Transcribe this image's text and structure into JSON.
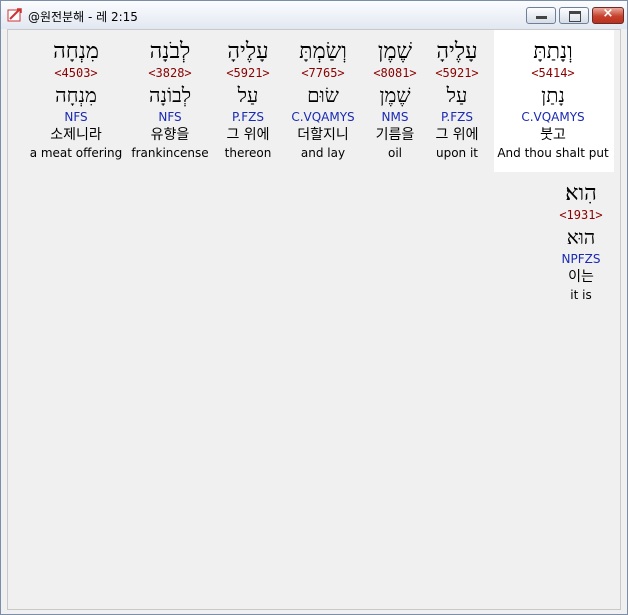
{
  "window": {
    "title": "@원전분해 - 레 2:15"
  },
  "titlebar": {
    "minimize": "minimize",
    "maximize": "maximize",
    "close": "×"
  },
  "verse": {
    "words": [
      {
        "hebrew": "וְנָתַתָּ",
        "strong": "<5414>",
        "lemma": "נָתַן",
        "parse": "C.VQAMYS",
        "korean": "붓고",
        "english": "And thou shalt put"
      },
      {
        "hebrew": "עָלֶיהָ",
        "strong": "<5921>",
        "lemma": "עַל",
        "parse": "P.FZS",
        "korean": "그 위에",
        "english": "upon it"
      },
      {
        "hebrew": "שֶׁמֶן",
        "strong": "<8081>",
        "lemma": "שֶׁמֶן",
        "parse": "NMS",
        "korean": "기름을",
        "english": "oil"
      },
      {
        "hebrew": "וְשַׂמְתָּ",
        "strong": "<7765>",
        "lemma": "שׂוּם",
        "parse": "C.VQAMYS",
        "korean": "더할지니",
        "english": "and lay"
      },
      {
        "hebrew": "עָלֶיהָ",
        "strong": "<5921>",
        "lemma": "עַל",
        "parse": "P.FZS",
        "korean": "그 위에",
        "english": "thereon"
      },
      {
        "hebrew": "לְבֹנָה",
        "strong": "<3828>",
        "lemma": "לְבוֹנָה",
        "parse": "NFS",
        "korean": "유향을",
        "english": "frankincense"
      },
      {
        "hebrew": "מִנְחָה",
        "strong": "<4503>",
        "lemma": "מִנְחָה",
        "parse": "NFS",
        "korean": "소제니라",
        "english": "a meat offering"
      },
      {
        "hebrew": "הִוא׃",
        "strong": "<1931>",
        "lemma": "הוּא",
        "parse": "NPFZS",
        "korean": "이는",
        "english": "it is"
      }
    ]
  },
  "colors": {
    "strong": "#8b0000",
    "parse": "#1a2ab3",
    "highlight": "#ffffff"
  }
}
